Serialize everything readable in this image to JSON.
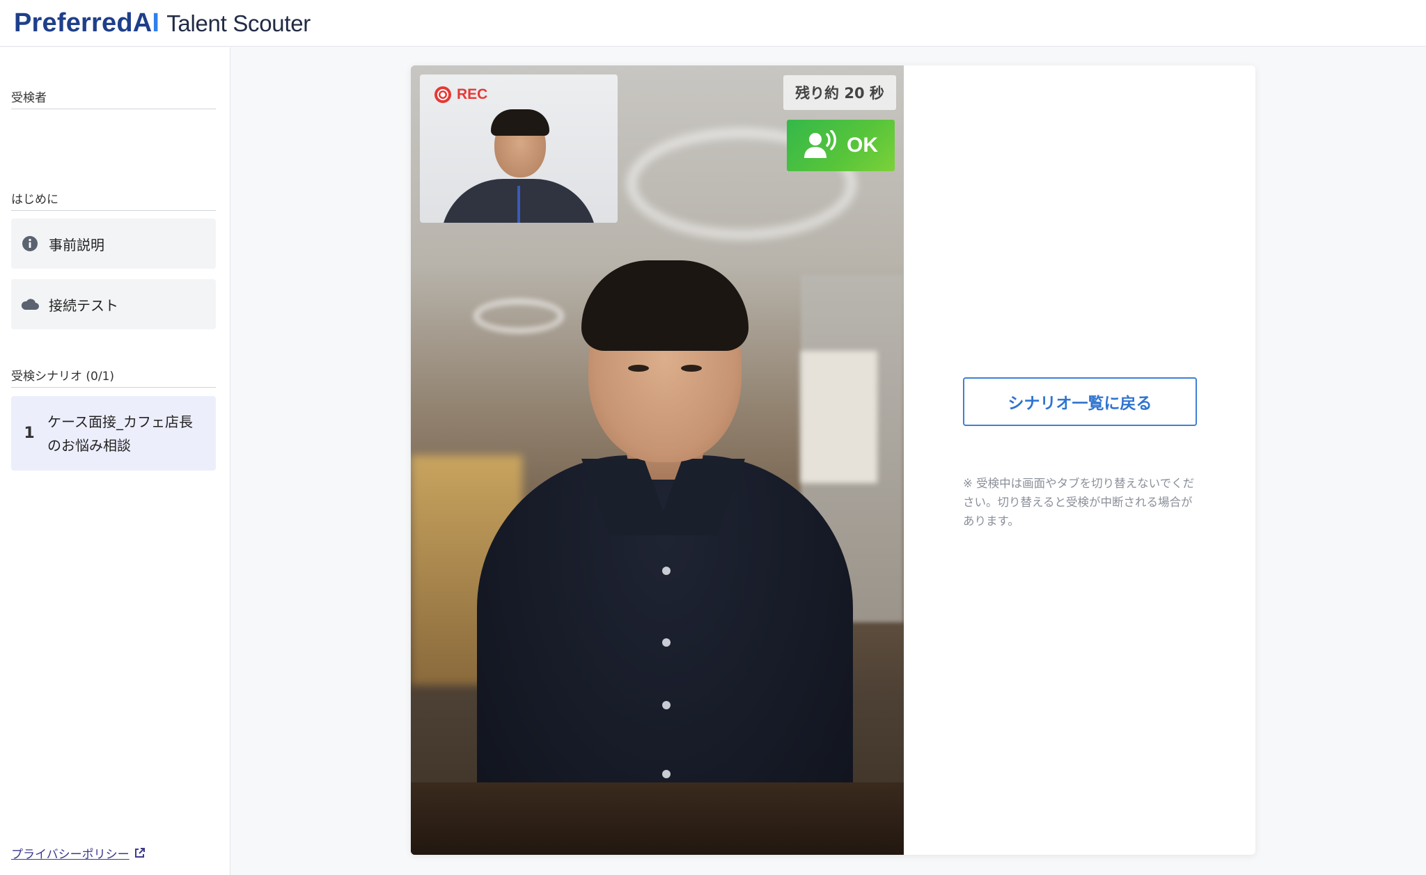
{
  "header": {
    "brand_main": "PreferredA",
    "brand_ai": "I",
    "product": "Talent Scouter"
  },
  "sidebar": {
    "section_examinee": "受検者",
    "section_intro": "はじめに",
    "intro_items": [
      {
        "label": "事前説明",
        "icon": "info-icon"
      },
      {
        "label": "接続テスト",
        "icon": "cloud-icon"
      }
    ],
    "section_scenarios": "受検シナリオ (0/1)",
    "scenarios": [
      {
        "number": "1",
        "title": "ケース面接_カフェ店長のお悩み相談"
      }
    ],
    "privacy_link": "プライバシーポリシー"
  },
  "video": {
    "rec_label": "REC",
    "timer_label": "残り約 20 秒",
    "ok_label": "OK"
  },
  "panel": {
    "back_button": "シナリオ一覧に戻る",
    "notice": "※ 受検中は画面やタブを切り替えないでください。切り替えると受検が中断される場合があります。"
  },
  "colors": {
    "accent": "#2f74d0",
    "brand": "#1e3f8a",
    "rec": "#e53935",
    "ok": "#3cb84a",
    "scenario_bg": "#eceefc"
  }
}
